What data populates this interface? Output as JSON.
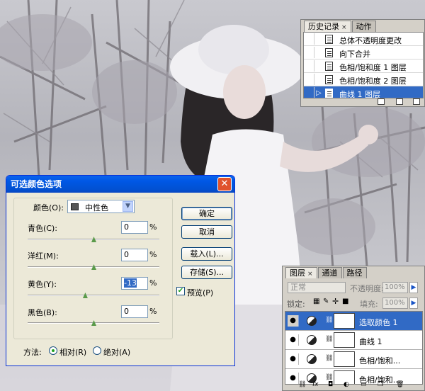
{
  "history_panel": {
    "tabs": [
      {
        "label": "历史记录",
        "close": "×"
      },
      {
        "label": "动作"
      }
    ],
    "items": [
      {
        "label": "总体不透明度更改"
      },
      {
        "label": "向下合并"
      },
      {
        "label": "色相/饱和度 1 图层"
      },
      {
        "label": "色相/饱和度 2 图层"
      },
      {
        "label": "曲线 1 图层",
        "selected": true
      }
    ],
    "current_marker": "▷"
  },
  "dialog": {
    "title": "可选颜色选项",
    "close_glyph": "✕",
    "colors_label": "颜色(O):",
    "colors_value": "中性色",
    "sliders": [
      {
        "label": "青色(C):",
        "value": "0",
        "unit": "%",
        "level": 0.5
      },
      {
        "label": "洋红(M):",
        "value": "0",
        "unit": "%",
        "level": 0.5
      },
      {
        "label": "黄色(Y):",
        "value": "-13",
        "unit": "%",
        "level": 0.435
      },
      {
        "label": "黑色(B):",
        "value": "0",
        "unit": "%",
        "level": 0.5
      }
    ],
    "buttons": {
      "ok": "确定",
      "cancel": "取消",
      "load": "载入(L)...",
      "save": "存储(S)..."
    },
    "preview_label": "预览(P)",
    "preview_checked": true,
    "method_label": "方法:",
    "method_options": [
      "相对(R)",
      "绝对(A)"
    ],
    "method_selected": 0
  },
  "layers_panel": {
    "tabs": [
      {
        "label": "图层",
        "close": "×"
      },
      {
        "label": "通道"
      },
      {
        "label": "路径"
      }
    ],
    "blend_mode": "正常",
    "opacity_label": "不透明度:",
    "opacity_value": "100%",
    "lock_label": "锁定:",
    "fill_label": "填充:",
    "fill_value": "100%",
    "layers": [
      {
        "name": "选取颜色 1",
        "selected": true
      },
      {
        "name": "曲线 1"
      },
      {
        "name": "色相/饱和..."
      },
      {
        "name": "色相/饱和..."
      }
    ],
    "footer_icons": [
      "link-icon",
      "fx-icon",
      "mask-icon",
      "adjustment-icon",
      "folder-icon",
      "new-layer-icon",
      "trash-icon"
    ]
  },
  "colors": {
    "accent": "#316ac5",
    "titlebar": "#0058e6",
    "panel_bg": "#d4d0c8",
    "dialog_bg": "#ece9d8"
  }
}
